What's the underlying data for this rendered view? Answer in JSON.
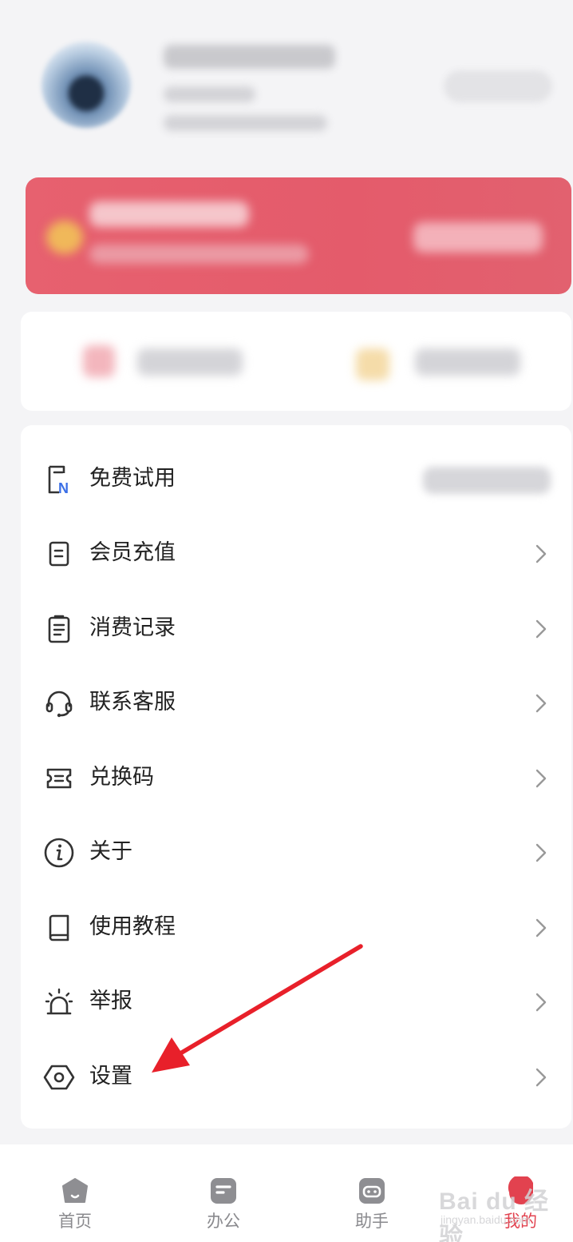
{
  "menu": {
    "items": [
      {
        "label": "免费试用",
        "icon": "trial-doc-n-icon"
      },
      {
        "label": "会员充值",
        "icon": "recharge-doc-icon"
      },
      {
        "label": "消费记录",
        "icon": "clipboard-list-icon"
      },
      {
        "label": "联系客服",
        "icon": "headset-icon"
      },
      {
        "label": "兑换码",
        "icon": "ticket-icon"
      },
      {
        "label": "关于",
        "icon": "info-icon"
      },
      {
        "label": "使用教程",
        "icon": "book-icon"
      },
      {
        "label": "举报",
        "icon": "alarm-siren-icon"
      },
      {
        "label": "设置",
        "icon": "hexagon-settings-icon"
      }
    ]
  },
  "bottom_nav": {
    "items": [
      {
        "label": "首页",
        "icon": "home-icon",
        "active": false
      },
      {
        "label": "办公",
        "icon": "office-icon",
        "active": false
      },
      {
        "label": "助手",
        "icon": "assistant-icon",
        "active": false
      },
      {
        "label": "我的",
        "icon": "profile-icon",
        "active": true
      }
    ]
  },
  "watermark": {
    "main": "Bai du 经验",
    "sub": "jingyan.baidu.com"
  },
  "colors": {
    "accent": "#e2424f",
    "banner": "#e45b6b",
    "background": "#f4f4f6",
    "arrow": "#e8202a"
  }
}
